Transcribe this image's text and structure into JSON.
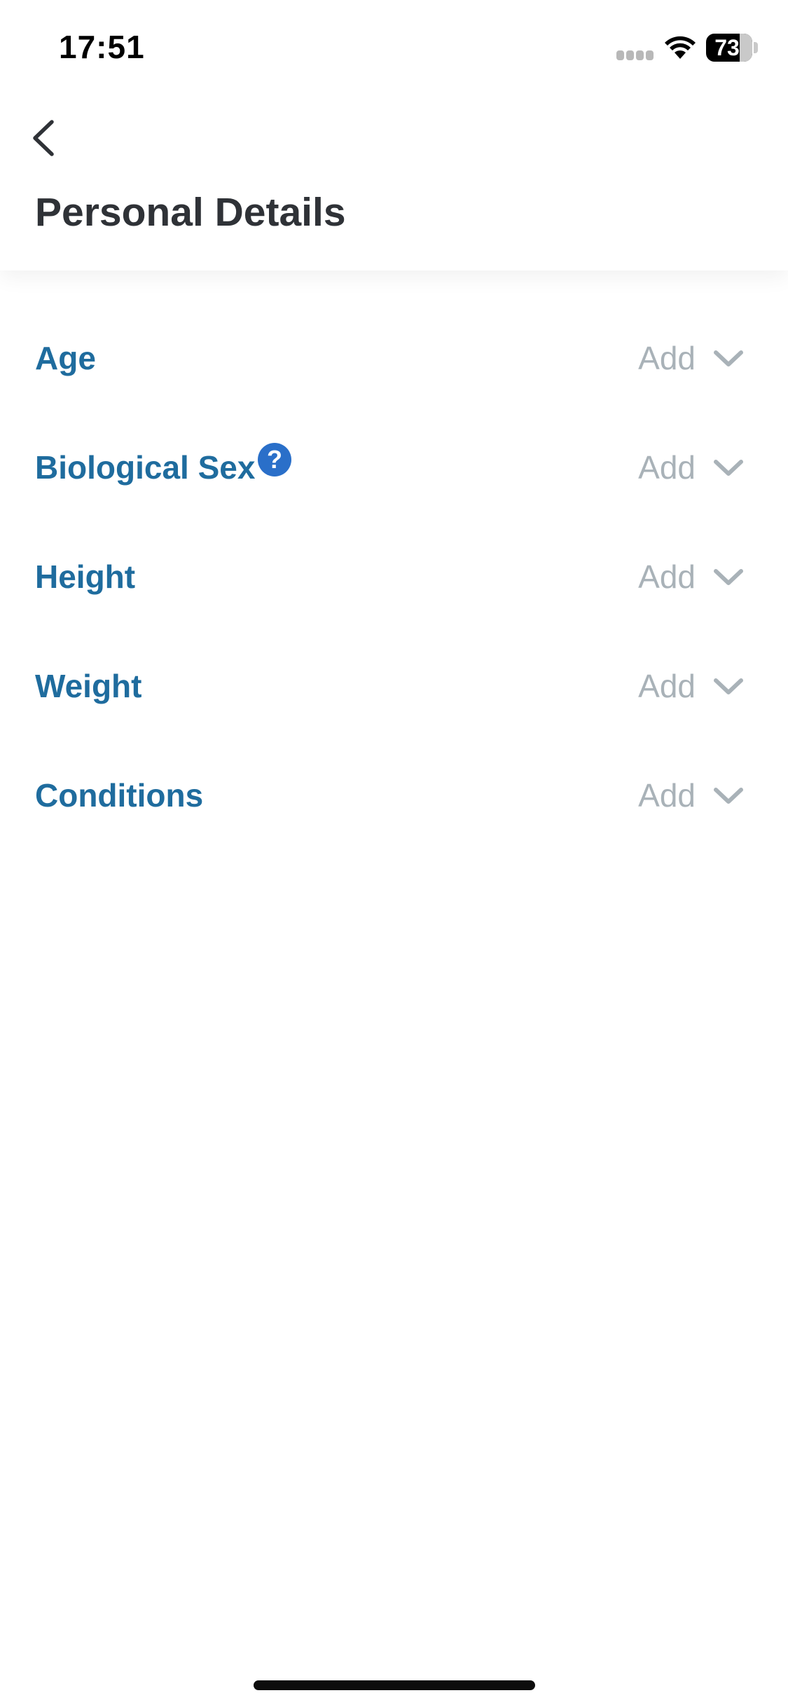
{
  "status_bar": {
    "time": "17:51",
    "battery": "73"
  },
  "header": {
    "title": "Personal Details"
  },
  "rows": [
    {
      "label": "Age",
      "action": "Add"
    },
    {
      "label": "Biological Sex",
      "action": "Add",
      "help_icon": "?"
    },
    {
      "label": "Height",
      "action": "Add"
    },
    {
      "label": "Weight",
      "action": "Add"
    },
    {
      "label": "Conditions",
      "action": "Add"
    }
  ],
  "colors": {
    "label": "#1f6c9e",
    "action": "#a9b2b8",
    "help_icon": "#2a6fc9",
    "title": "#2f3237"
  },
  "icons": {
    "back": "chevron-left-icon",
    "row_expand": "chevron-down-icon",
    "help": "question-mark-icon"
  }
}
